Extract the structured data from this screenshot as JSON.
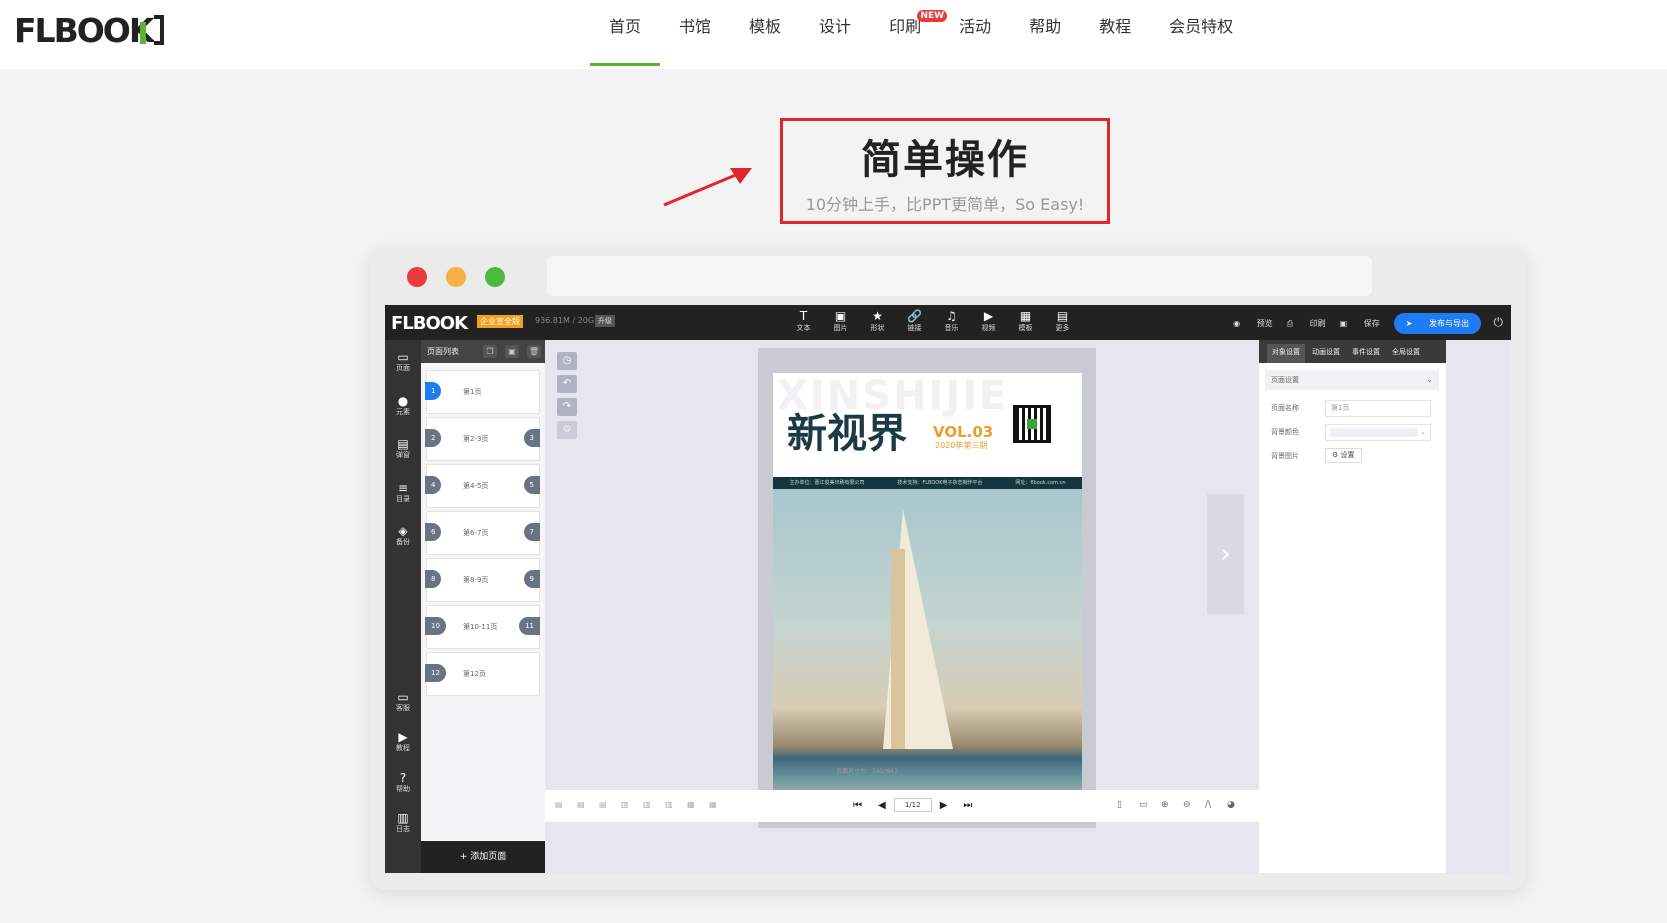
{
  "logo": {
    "text": "FLBOOK"
  },
  "nav": {
    "items": [
      {
        "label": "首页",
        "active": true
      },
      {
        "label": "书馆"
      },
      {
        "label": "模板"
      },
      {
        "label": "设计"
      },
      {
        "label": "印刷",
        "badge": "NEW"
      },
      {
        "label": "活动"
      },
      {
        "label": "帮助"
      },
      {
        "label": "教程"
      },
      {
        "label": "会员特权"
      }
    ]
  },
  "hero": {
    "title": "简单操作",
    "subtitle": "10分钟上手，比PPT更简单，So Easy!"
  },
  "editor": {
    "logo": "FLBOOK",
    "plan_badge": "企业宣全版",
    "storage": "936.81M / 20G",
    "upgrade": "升级",
    "tools": [
      {
        "icon": "T",
        "label": "文本"
      },
      {
        "icon": "▣",
        "label": "图片"
      },
      {
        "icon": "★",
        "label": "形状"
      },
      {
        "icon": "🔗",
        "label": "链接"
      },
      {
        "icon": "♫",
        "label": "音乐"
      },
      {
        "icon": "▶",
        "label": "视频"
      },
      {
        "icon": "▦",
        "label": "模板"
      },
      {
        "icon": "▤",
        "label": "更多"
      }
    ],
    "actions": {
      "preview": "预览",
      "print": "印刷",
      "save": "保存",
      "publish": "发布与导出"
    },
    "side": {
      "top": [
        {
          "icon": "▭",
          "label": "页面"
        },
        {
          "icon": "●",
          "label": "元素"
        },
        {
          "icon": "▤",
          "label": "弹窗"
        },
        {
          "icon": "≡",
          "label": "目录"
        },
        {
          "icon": "◈",
          "label": "备份"
        }
      ],
      "bottom": [
        {
          "icon": "▭",
          "label": "客服"
        },
        {
          "icon": "▶",
          "label": "教程"
        },
        {
          "icon": "?",
          "label": "帮助"
        },
        {
          "icon": "▥",
          "label": "日志"
        }
      ]
    },
    "pages_panel": {
      "title": "页面列表",
      "pages": [
        {
          "left": "1",
          "label": "第1页"
        },
        {
          "left": "2",
          "right": "3",
          "label": "第2-3页"
        },
        {
          "left": "4",
          "right": "5",
          "label": "第4-5页"
        },
        {
          "left": "6",
          "right": "7",
          "label": "第6-7页"
        },
        {
          "left": "8",
          "right": "9",
          "label": "第8-9页"
        },
        {
          "left": "10",
          "right": "11",
          "label": "第10-11页"
        },
        {
          "left": "12",
          "label": "第12页"
        }
      ],
      "add_label": "+ 添加页面"
    },
    "cover": {
      "bg_text": "XINSHIJIE",
      "title": "新视界",
      "vol": "VOL.03",
      "issue": "2020年第三期",
      "strip": [
        "主办单位：晋江俊美印刷有限公司",
        "技术支持：FLBOOK电子杂志制作平台",
        "网址：flbook.com.cn"
      ],
      "size_note": "页面尺寸为：595*841"
    },
    "pager": {
      "value": "1/12"
    },
    "right_panel": {
      "tabs": [
        "对象设置",
        "动画设置",
        "事件设置",
        "全局设置"
      ],
      "section": "页面设置",
      "name_label": "页面名称",
      "name_value": "第1页",
      "bgcolor_label": "背景颜色",
      "bgimage_label": "背景图片",
      "set_button": "设置"
    }
  },
  "colors": {
    "accent": "#5cb531",
    "highlight": "#e0252b",
    "publish": "#1e7cf5"
  }
}
